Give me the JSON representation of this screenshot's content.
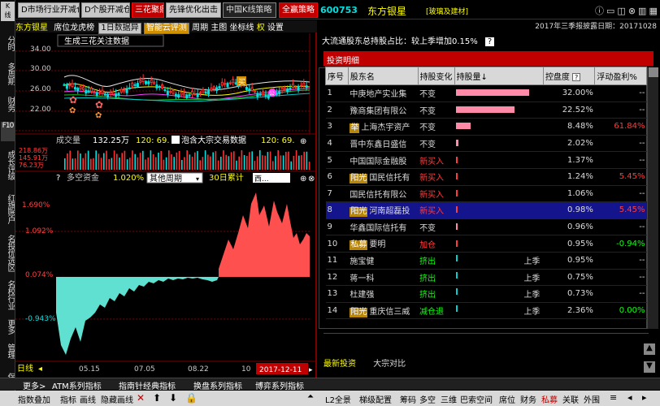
{
  "top_tabs": [
    "D市场行业开减仓",
    "D个股开减仓",
    "三花聚鼎",
    "先锋优化出击",
    "中国K线策略",
    "全赢策略"
  ],
  "stock": {
    "code": "600753",
    "name": "东方银星",
    "sector": "[玻璃及建材]",
    "report_date": "2017年三季报披露日期：20171028"
  },
  "window_icons": [
    "info-icon",
    "minimize-icon",
    "maximize-icon",
    "close-icon",
    "settings-icon",
    "grid-icon"
  ],
  "left_nav": [
    "分时",
    "多周期",
    "财务",
    "F10",
    "成长评级",
    "红旗账户",
    "名投优选区",
    "名校行业",
    "更多",
    "管理",
    "保存"
  ],
  "chart_toolbar": {
    "name": "东方银星",
    "items": [
      "席位龙虎榜",
      "1日数据异",
      "智能云评测",
      "周期",
      "主图",
      "坐标线",
      "权",
      "设置"
    ]
  },
  "main_chart": {
    "legend": "生成三花关注数据",
    "price_ticks": [
      "34.00",
      "30.00",
      "26.00",
      "22.00"
    ],
    "buy_label": "买",
    "annot": "公"
  },
  "volume": {
    "label": "成交量",
    "value": "132.25万",
    "p1": "120: 69.",
    "p2": "120: 69.",
    "title": "泡含大宗交易数据",
    "ticks": [
      "218.86万",
      "145.91万",
      "76.23万"
    ]
  },
  "capital": {
    "label": "多空资金",
    "value": "1.020%",
    "period_select": "其他周期",
    "cumulative": "30日累计",
    "input_placeholder": "西...",
    "ticks": [
      "1.690%",
      "1.092%",
      "0.074%",
      "-0.943%"
    ]
  },
  "timeline": {
    "label": "日线",
    "dates": [
      "05.15",
      "07.05",
      "08.22",
      "10"
    ],
    "last_date": "2017-12-11"
  },
  "holdings_title": "大流通股东总持股占比：较上季增加0.15%",
  "holdings_tab": "投资明细",
  "holdings_headers": [
    "序号",
    "股东名",
    "持股变化",
    "持股量↓",
    "控盘度",
    "浮动盈利%"
  ],
  "holdings": [
    {
      "rank": "1",
      "tag": "",
      "name": "中庚地产实业集",
      "change": "不变",
      "bar": 90,
      "bar_color": "#ff8aa8",
      "season": "",
      "ctrl": "32.00%",
      "profit": "--",
      "profit_color": "#dcdcdc",
      "change_color": "#dcdcdc"
    },
    {
      "rank": "2",
      "tag": "",
      "name": "豫商集团有限公",
      "change": "不变",
      "bar": 72,
      "bar_color": "#ff8aa8",
      "season": "",
      "ctrl": "22.52%",
      "profit": "--",
      "profit_color": "#dcdcdc",
      "change_color": "#dcdcdc"
    },
    {
      "rank": "3",
      "tag": "举",
      "name": "上海杰宇资产",
      "change": "不变",
      "bar": 18,
      "bar_color": "#ff8aa8",
      "season": "",
      "ctrl": "8.48%",
      "profit": "61.84%",
      "profit_color": "#ff3c3c",
      "change_color": "#dcdcdc"
    },
    {
      "rank": "4",
      "tag": "",
      "name": "晋中东鑫日盛信",
      "change": "不变",
      "bar": 3,
      "bar_color": "#ff8aa8",
      "season": "",
      "ctrl": "2.02%",
      "profit": "--",
      "profit_color": "#dcdcdc",
      "change_color": "#dcdcdc"
    },
    {
      "rank": "5",
      "tag": "",
      "name": "中国国际金融股",
      "change": "新买入",
      "bar": 2,
      "bar_color": "#ff3c3c",
      "season": "",
      "ctrl": "1.37%",
      "profit": "--",
      "profit_color": "#dcdcdc",
      "change_color": "#ff3c3c"
    },
    {
      "rank": "6",
      "tag": "阳光",
      "name": "国民信托有",
      "change": "新买入",
      "bar": 2,
      "bar_color": "#ff3c3c",
      "season": "",
      "ctrl": "1.24%",
      "profit": "5.45%",
      "profit_color": "#ff3c3c",
      "change_color": "#ff3c3c"
    },
    {
      "rank": "7",
      "tag": "",
      "name": "国民信托有限公",
      "change": "新买入",
      "bar": 2,
      "bar_color": "#ff3c3c",
      "season": "",
      "ctrl": "1.06%",
      "profit": "--",
      "profit_color": "#dcdcdc",
      "change_color": "#ff3c3c"
    },
    {
      "rank": "8",
      "tag": "阳光",
      "name": "河南超磊投",
      "change": "新买入",
      "bar": 2,
      "bar_color": "#ff3c3c",
      "season": "",
      "ctrl": "0.98%",
      "profit": "5.45%",
      "profit_color": "#ff3c3c",
      "change_color": "#ff3c3c"
    },
    {
      "rank": "9",
      "tag": "",
      "name": "华鑫国际信托有",
      "change": "不变",
      "bar": 2,
      "bar_color": "#ff8aa8",
      "season": "",
      "ctrl": "0.96%",
      "profit": "--",
      "profit_color": "#dcdcdc",
      "change_color": "#dcdcdc"
    },
    {
      "rank": "10",
      "tag": "私募",
      "name": "要明",
      "change": "加仓",
      "bar": 2,
      "bar_color": "#ff3c3c",
      "season": "",
      "ctrl": "0.95%",
      "profit": "-0.94%",
      "profit_color": "#10ff10",
      "change_color": "#ff3c3c"
    },
    {
      "rank": "11",
      "tag": "",
      "name": "施宝健",
      "change": "挤出",
      "bar": 2,
      "bar_color": "#00d0d0",
      "season": "上季",
      "ctrl": "0.95%",
      "profit": "--",
      "profit_color": "#dcdcdc",
      "change_color": "#10ff10"
    },
    {
      "rank": "12",
      "tag": "",
      "name": "蒋一科",
      "change": "挤出",
      "bar": 2,
      "bar_color": "#00d0d0",
      "season": "上季",
      "ctrl": "0.75%",
      "profit": "--",
      "profit_color": "#dcdcdc",
      "change_color": "#10ff10"
    },
    {
      "rank": "13",
      "tag": "",
      "name": "杜建强",
      "change": "挤出",
      "bar": 2,
      "bar_color": "#00d0d0",
      "season": "上季",
      "ctrl": "0.73%",
      "profit": "--",
      "profit_color": "#dcdcdc",
      "change_color": "#10ff10"
    },
    {
      "rank": "14",
      "tag": "阳光",
      "name": "重庆信三威",
      "change": "减仓退",
      "bar": 2,
      "bar_color": "#00d0d0",
      "season": "上季",
      "ctrl": "2.36%",
      "profit": "0.00%",
      "profit_color": "#10ff10",
      "change_color": "#10ff10"
    }
  ],
  "bottom_tabs": [
    "最新投资",
    "大宗对比"
  ],
  "bottom1": [
    "更多>",
    "ATM系列指标",
    "指南针经典指标",
    "换盘系列指标",
    "博弈系列指标"
  ],
  "bottom2_left": [
    "指数叠加",
    "指标",
    "画线",
    "隐藏画线"
  ],
  "bottom2_right": [
    "L2全景",
    "梯级配置",
    "筹码",
    "多空",
    "三维",
    "巴索空间",
    "席位",
    "财务",
    "私募",
    "关联",
    "外围"
  ],
  "colors": {
    "accent": "#c00000",
    "selected_row": "#14148c",
    "rise": "#ff3c3c",
    "fall": "#00e0e0"
  }
}
